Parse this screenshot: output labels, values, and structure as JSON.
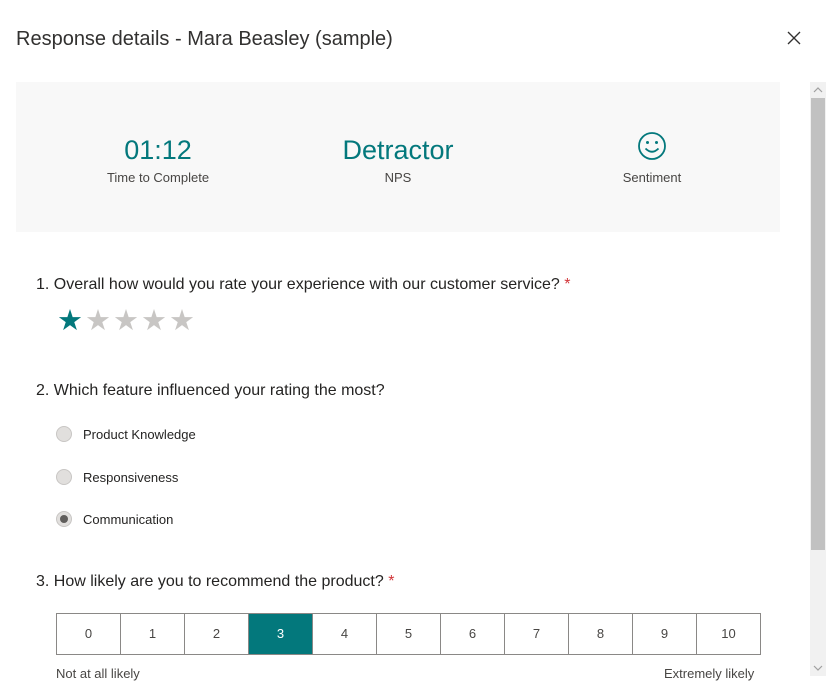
{
  "header": {
    "title": "Response details - Mara Beasley (sample)"
  },
  "summary": {
    "time": {
      "value": "01:12",
      "label": "Time to Complete"
    },
    "nps": {
      "value": "Detractor",
      "label": "NPS"
    },
    "sentiment": {
      "icon": "smile-icon",
      "label": "Sentiment"
    }
  },
  "questions": {
    "q1": {
      "text": "1. Overall how would you rate your experience with our customer service?",
      "required": "*",
      "rating": 1,
      "max": 5
    },
    "q2": {
      "text": "2. Which feature influenced your rating the most?",
      "options": [
        "Product Knowledge",
        "Responsiveness",
        "Communication"
      ],
      "selected": "Communication"
    },
    "q3": {
      "text": "3. How likely are you to recommend the product?",
      "required": "*",
      "scale": [
        "0",
        "1",
        "2",
        "3",
        "4",
        "5",
        "6",
        "7",
        "8",
        "9",
        "10"
      ],
      "selected": "3",
      "low_label": "Not at all likely",
      "high_label": "Extremely likely"
    }
  },
  "colors": {
    "accent": "#03787c",
    "required": "#d13438"
  }
}
